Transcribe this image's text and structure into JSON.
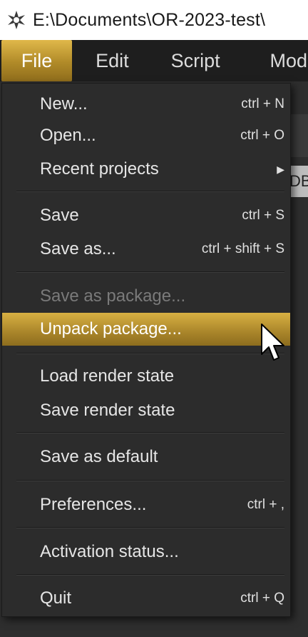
{
  "window": {
    "title": "E:\\Documents\\OR-2023-test\\"
  },
  "menubar": {
    "items": [
      "File",
      "Edit",
      "Script",
      "Mod"
    ]
  },
  "file_menu": {
    "new": {
      "label": "New...",
      "shortcut": "ctrl + N"
    },
    "open": {
      "label": "Open...",
      "shortcut": "ctrl + O"
    },
    "recent": {
      "label": "Recent projects"
    },
    "save": {
      "label": "Save",
      "shortcut": "ctrl + S"
    },
    "save_as": {
      "label": "Save as...",
      "shortcut": "ctrl + shift + S"
    },
    "save_package": {
      "label": "Save as package..."
    },
    "unpack_package": {
      "label": "Unpack package..."
    },
    "load_render": {
      "label": "Load render state"
    },
    "save_render": {
      "label": "Save render state"
    },
    "save_default": {
      "label": "Save as default"
    },
    "preferences": {
      "label": "Preferences...",
      "shortcut": "ctrl + ,"
    },
    "activation": {
      "label": "Activation status..."
    },
    "quit": {
      "label": "Quit",
      "shortcut": "ctrl + Q"
    }
  },
  "background": {
    "tab_fragment": "DB"
  },
  "colors": {
    "accent": "#c9a23a",
    "menu_bg": "#2c2c2c",
    "menubar_bg": "#1e1e1e"
  }
}
